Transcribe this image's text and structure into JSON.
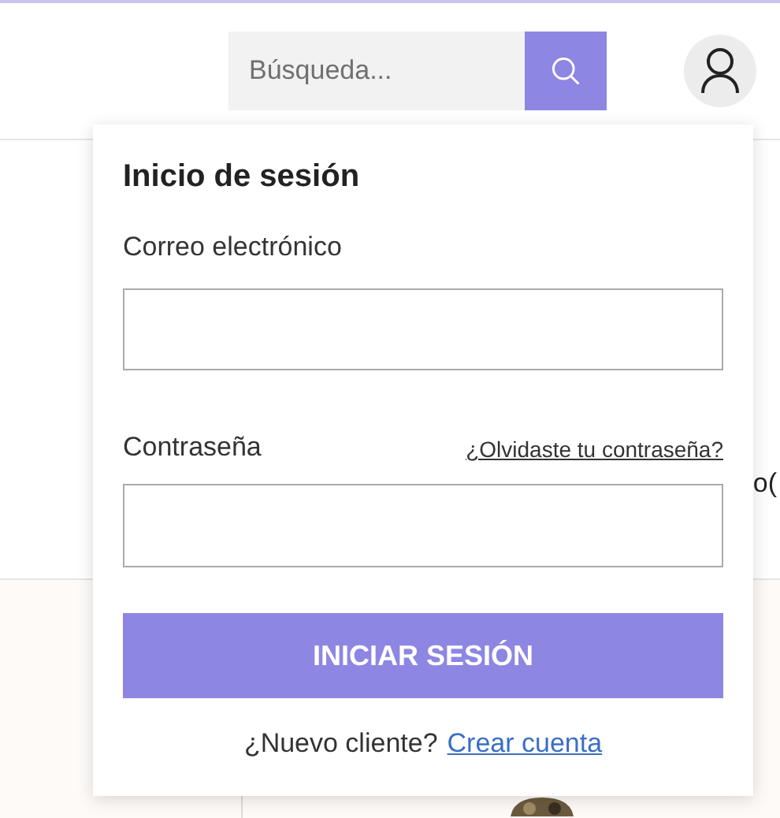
{
  "header": {
    "search": {
      "placeholder": "Búsqueda..."
    }
  },
  "page": {
    "partial_text": "o("
  },
  "login_dropdown": {
    "title": "Inicio de sesión",
    "email": {
      "label": "Correo electrónico"
    },
    "password": {
      "label": "Contraseña",
      "forgot_link": "¿Olvidaste tu contraseña?"
    },
    "submit": "INICIAR SESIÓN",
    "new_customer": {
      "text": "¿Nuevo cliente?",
      "link": "Crear cuenta"
    }
  }
}
